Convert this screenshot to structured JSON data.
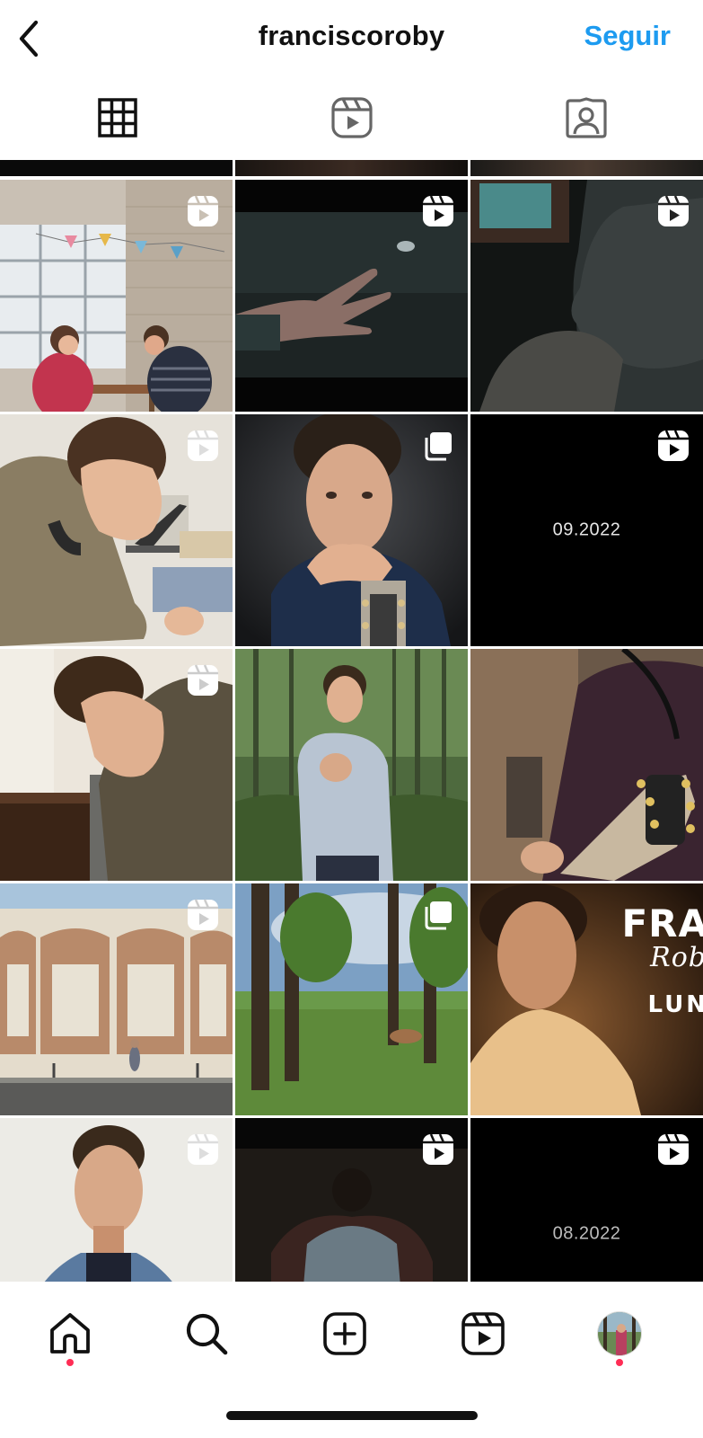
{
  "header": {
    "username": "franciscoroby",
    "follow_label": "Seguir",
    "back_icon": "chevron-left-icon"
  },
  "tabs": [
    {
      "name": "grid",
      "icon": "grid-icon",
      "active": true
    },
    {
      "name": "reels",
      "icon": "reels-icon",
      "active": false
    },
    {
      "name": "tagged",
      "icon": "tagged-user-icon",
      "active": false
    }
  ],
  "posts": {
    "rows": [
      [
        {
          "type": "reel",
          "scene": "couple-at-cafe-table"
        },
        {
          "type": "reel",
          "scene": "dark-hand-closeup"
        },
        {
          "type": "reel",
          "scene": "man-profile-dark"
        }
      ],
      [
        {
          "type": "reel",
          "scene": "man-with-laptop"
        },
        {
          "type": "carousel",
          "scene": "man-portrait-hands-guitar"
        },
        {
          "type": "reel",
          "scene": "black-card",
          "text": "09.2022"
        }
      ],
      [
        {
          "type": "reel",
          "scene": "man-leaning-desk"
        },
        {
          "type": "none",
          "scene": "man-in-forest"
        },
        {
          "type": "none",
          "scene": "guitar-closeup"
        }
      ],
      [
        {
          "type": "reel",
          "scene": "brick-wall-street"
        },
        {
          "type": "carousel",
          "scene": "forest-clearing"
        },
        {
          "type": "none",
          "scene": "man-warm-light",
          "overlay": [
            "FRA",
            "Rob",
            "LUN"
          ]
        }
      ],
      [
        {
          "type": "reel",
          "scene": "man-denim-portrait"
        },
        {
          "type": "reel",
          "scene": "man-back-dark"
        },
        {
          "type": "reel",
          "scene": "black-card",
          "text": "08.2022"
        }
      ]
    ]
  },
  "bottom_nav": {
    "items": [
      {
        "name": "home",
        "icon": "home-icon",
        "dot": true
      },
      {
        "name": "search",
        "icon": "search-icon",
        "dot": false
      },
      {
        "name": "create",
        "icon": "plus-square-icon",
        "dot": false
      },
      {
        "name": "reels",
        "icon": "reels-icon",
        "dot": false
      },
      {
        "name": "profile",
        "icon": "avatar-icon",
        "dot": true
      }
    ]
  },
  "colors": {
    "accent": "#1d9bf0",
    "notification_dot": "#ff2d55"
  }
}
